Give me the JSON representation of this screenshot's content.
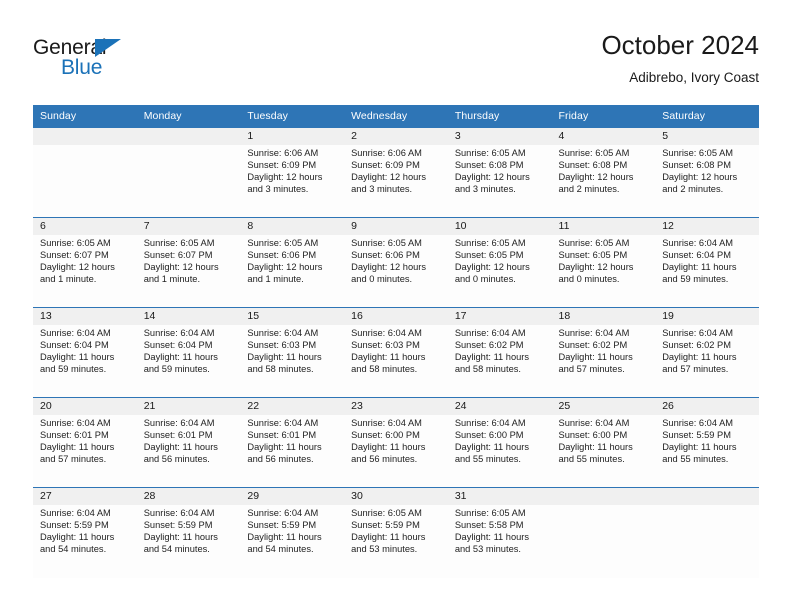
{
  "brand": {
    "name_top": "General",
    "name_bottom": "Blue",
    "triangle_color": "#1b72b8",
    "top_color": "#1a1a1a"
  },
  "header": {
    "title": "October 2024",
    "subtitle": "Adibrebo, Ivory Coast"
  },
  "theme": {
    "header_bg": "#2e75b6",
    "header_text": "#ffffff",
    "daynum_band_bg": "#f0f0f0",
    "cell_bg": "#fdfdfd",
    "border": "#2e75b6"
  },
  "weekday_headers": [
    "Sunday",
    "Monday",
    "Tuesday",
    "Wednesday",
    "Thursday",
    "Friday",
    "Saturday"
  ],
  "weeks": [
    [
      {
        "day": "",
        "empty": true
      },
      {
        "day": "",
        "empty": true
      },
      {
        "day": "1",
        "sunrise": "Sunrise: 6:06 AM",
        "sunset": "Sunset: 6:09 PM",
        "daylight1": "Daylight: 12 hours",
        "daylight2": "and 3 minutes."
      },
      {
        "day": "2",
        "sunrise": "Sunrise: 6:06 AM",
        "sunset": "Sunset: 6:09 PM",
        "daylight1": "Daylight: 12 hours",
        "daylight2": "and 3 minutes."
      },
      {
        "day": "3",
        "sunrise": "Sunrise: 6:05 AM",
        "sunset": "Sunset: 6:08 PM",
        "daylight1": "Daylight: 12 hours",
        "daylight2": "and 3 minutes."
      },
      {
        "day": "4",
        "sunrise": "Sunrise: 6:05 AM",
        "sunset": "Sunset: 6:08 PM",
        "daylight1": "Daylight: 12 hours",
        "daylight2": "and 2 minutes."
      },
      {
        "day": "5",
        "sunrise": "Sunrise: 6:05 AM",
        "sunset": "Sunset: 6:08 PM",
        "daylight1": "Daylight: 12 hours",
        "daylight2": "and 2 minutes."
      }
    ],
    [
      {
        "day": "6",
        "sunrise": "Sunrise: 6:05 AM",
        "sunset": "Sunset: 6:07 PM",
        "daylight1": "Daylight: 12 hours",
        "daylight2": "and 1 minute."
      },
      {
        "day": "7",
        "sunrise": "Sunrise: 6:05 AM",
        "sunset": "Sunset: 6:07 PM",
        "daylight1": "Daylight: 12 hours",
        "daylight2": "and 1 minute."
      },
      {
        "day": "8",
        "sunrise": "Sunrise: 6:05 AM",
        "sunset": "Sunset: 6:06 PM",
        "daylight1": "Daylight: 12 hours",
        "daylight2": "and 1 minute."
      },
      {
        "day": "9",
        "sunrise": "Sunrise: 6:05 AM",
        "sunset": "Sunset: 6:06 PM",
        "daylight1": "Daylight: 12 hours",
        "daylight2": "and 0 minutes."
      },
      {
        "day": "10",
        "sunrise": "Sunrise: 6:05 AM",
        "sunset": "Sunset: 6:05 PM",
        "daylight1": "Daylight: 12 hours",
        "daylight2": "and 0 minutes."
      },
      {
        "day": "11",
        "sunrise": "Sunrise: 6:05 AM",
        "sunset": "Sunset: 6:05 PM",
        "daylight1": "Daylight: 12 hours",
        "daylight2": "and 0 minutes."
      },
      {
        "day": "12",
        "sunrise": "Sunrise: 6:04 AM",
        "sunset": "Sunset: 6:04 PM",
        "daylight1": "Daylight: 11 hours",
        "daylight2": "and 59 minutes."
      }
    ],
    [
      {
        "day": "13",
        "sunrise": "Sunrise: 6:04 AM",
        "sunset": "Sunset: 6:04 PM",
        "daylight1": "Daylight: 11 hours",
        "daylight2": "and 59 minutes."
      },
      {
        "day": "14",
        "sunrise": "Sunrise: 6:04 AM",
        "sunset": "Sunset: 6:04 PM",
        "daylight1": "Daylight: 11 hours",
        "daylight2": "and 59 minutes."
      },
      {
        "day": "15",
        "sunrise": "Sunrise: 6:04 AM",
        "sunset": "Sunset: 6:03 PM",
        "daylight1": "Daylight: 11 hours",
        "daylight2": "and 58 minutes."
      },
      {
        "day": "16",
        "sunrise": "Sunrise: 6:04 AM",
        "sunset": "Sunset: 6:03 PM",
        "daylight1": "Daylight: 11 hours",
        "daylight2": "and 58 minutes."
      },
      {
        "day": "17",
        "sunrise": "Sunrise: 6:04 AM",
        "sunset": "Sunset: 6:02 PM",
        "daylight1": "Daylight: 11 hours",
        "daylight2": "and 58 minutes."
      },
      {
        "day": "18",
        "sunrise": "Sunrise: 6:04 AM",
        "sunset": "Sunset: 6:02 PM",
        "daylight1": "Daylight: 11 hours",
        "daylight2": "and 57 minutes."
      },
      {
        "day": "19",
        "sunrise": "Sunrise: 6:04 AM",
        "sunset": "Sunset: 6:02 PM",
        "daylight1": "Daylight: 11 hours",
        "daylight2": "and 57 minutes."
      }
    ],
    [
      {
        "day": "20",
        "sunrise": "Sunrise: 6:04 AM",
        "sunset": "Sunset: 6:01 PM",
        "daylight1": "Daylight: 11 hours",
        "daylight2": "and 57 minutes."
      },
      {
        "day": "21",
        "sunrise": "Sunrise: 6:04 AM",
        "sunset": "Sunset: 6:01 PM",
        "daylight1": "Daylight: 11 hours",
        "daylight2": "and 56 minutes."
      },
      {
        "day": "22",
        "sunrise": "Sunrise: 6:04 AM",
        "sunset": "Sunset: 6:01 PM",
        "daylight1": "Daylight: 11 hours",
        "daylight2": "and 56 minutes."
      },
      {
        "day": "23",
        "sunrise": "Sunrise: 6:04 AM",
        "sunset": "Sunset: 6:00 PM",
        "daylight1": "Daylight: 11 hours",
        "daylight2": "and 56 minutes."
      },
      {
        "day": "24",
        "sunrise": "Sunrise: 6:04 AM",
        "sunset": "Sunset: 6:00 PM",
        "daylight1": "Daylight: 11 hours",
        "daylight2": "and 55 minutes."
      },
      {
        "day": "25",
        "sunrise": "Sunrise: 6:04 AM",
        "sunset": "Sunset: 6:00 PM",
        "daylight1": "Daylight: 11 hours",
        "daylight2": "and 55 minutes."
      },
      {
        "day": "26",
        "sunrise": "Sunrise: 6:04 AM",
        "sunset": "Sunset: 5:59 PM",
        "daylight1": "Daylight: 11 hours",
        "daylight2": "and 55 minutes."
      }
    ],
    [
      {
        "day": "27",
        "sunrise": "Sunrise: 6:04 AM",
        "sunset": "Sunset: 5:59 PM",
        "daylight1": "Daylight: 11 hours",
        "daylight2": "and 54 minutes."
      },
      {
        "day": "28",
        "sunrise": "Sunrise: 6:04 AM",
        "sunset": "Sunset: 5:59 PM",
        "daylight1": "Daylight: 11 hours",
        "daylight2": "and 54 minutes."
      },
      {
        "day": "29",
        "sunrise": "Sunrise: 6:04 AM",
        "sunset": "Sunset: 5:59 PM",
        "daylight1": "Daylight: 11 hours",
        "daylight2": "and 54 minutes."
      },
      {
        "day": "30",
        "sunrise": "Sunrise: 6:05 AM",
        "sunset": "Sunset: 5:59 PM",
        "daylight1": "Daylight: 11 hours",
        "daylight2": "and 53 minutes."
      },
      {
        "day": "31",
        "sunrise": "Sunrise: 6:05 AM",
        "sunset": "Sunset: 5:58 PM",
        "daylight1": "Daylight: 11 hours",
        "daylight2": "and 53 minutes."
      },
      {
        "day": "",
        "empty": true
      },
      {
        "day": "",
        "empty": true
      }
    ]
  ]
}
